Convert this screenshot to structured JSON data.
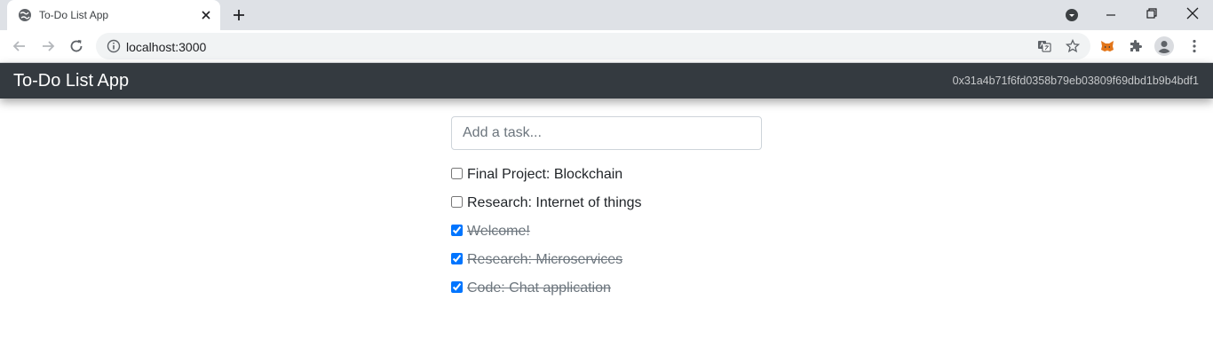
{
  "browser": {
    "tab_title": "To-Do List App",
    "url": "localhost:3000"
  },
  "app": {
    "title": "To-Do List App",
    "account": "0x31a4b71f6fd0358b79eb03809f69dbd1b9b4bdf1",
    "input_placeholder": "Add a task...",
    "tasks": [
      {
        "label": "Final Project: Blockchain",
        "completed": false
      },
      {
        "label": "Research: Internet of things",
        "completed": false
      },
      {
        "label": "Welcome!",
        "completed": true
      },
      {
        "label": "Research: Microservices",
        "completed": true
      },
      {
        "label": "Code: Chat application",
        "completed": true
      }
    ]
  },
  "colors": {
    "navbar": "#343a40",
    "checkbox_accent": "#0075ff",
    "completed_text": "#6c757d"
  }
}
